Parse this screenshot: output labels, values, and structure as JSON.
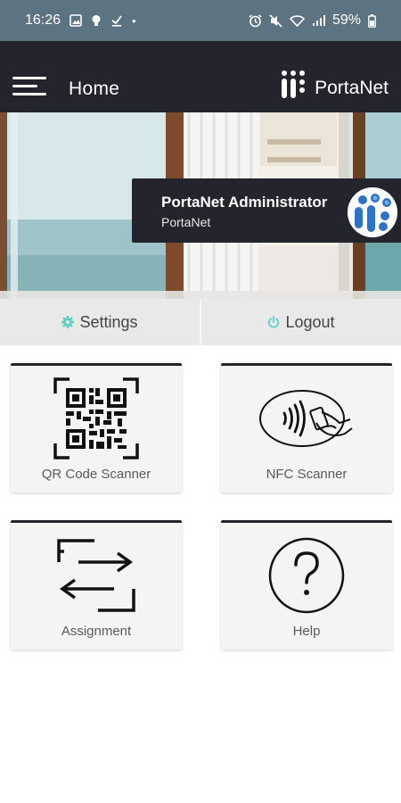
{
  "status_bar": {
    "time": "16:26",
    "battery": "59%",
    "left_icons": [
      "gallery-icon",
      "bulb-icon",
      "download-check-icon",
      "dot-icon"
    ],
    "right_icons": [
      "alarm-icon",
      "mute-icon",
      "wifi-icon",
      "signal-icon",
      "battery-icon"
    ]
  },
  "app_bar": {
    "title": "Home",
    "brand": "PortaNet",
    "menu_icon": "hamburger-menu-icon",
    "logo_icon": "portanet-logo-icon"
  },
  "profile": {
    "name": "PortaNet Administrator",
    "organization": "PortaNet"
  },
  "actions": {
    "settings_label": "Settings",
    "logout_label": "Logout",
    "accent_color": "#5fd0c4"
  },
  "tiles": [
    {
      "label": "QR Code Scanner",
      "icon": "qr-code-icon"
    },
    {
      "label": "NFC Scanner",
      "icon": "nfc-icon"
    },
    {
      "label": "Assignment",
      "icon": "swap-arrows-icon"
    },
    {
      "label": "Help",
      "icon": "help-icon"
    }
  ],
  "colors": {
    "status_bar": "#5c7481",
    "app_bar": "#23242c",
    "action_bar": "#e9e9e9",
    "tile_bg": "#f4f4f4"
  }
}
